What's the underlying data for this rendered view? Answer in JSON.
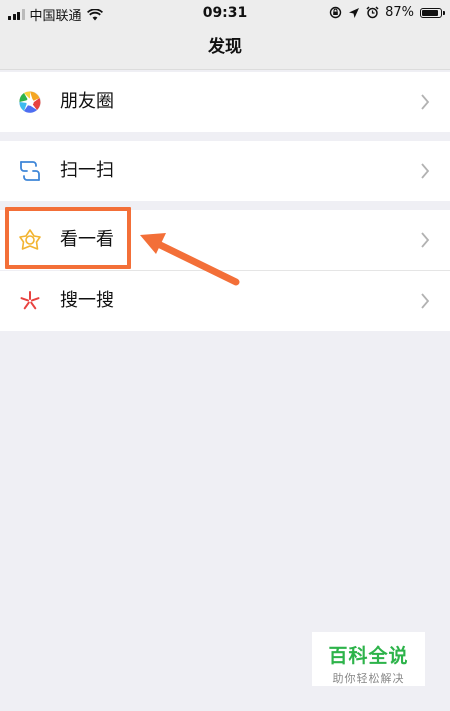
{
  "status_bar": {
    "carrier": "中国联通",
    "time": "09:31",
    "battery_percent": "87%",
    "battery_level": 0.87
  },
  "nav": {
    "title": "发现"
  },
  "menu": {
    "moments": {
      "label": "朋友圈",
      "icon": "moments-aperture-icon"
    },
    "scan": {
      "label": "扫一扫",
      "icon": "scan-icon"
    },
    "top_stories": {
      "label": "看一看",
      "icon": "top-stories-icon"
    },
    "search": {
      "label": "搜一搜",
      "icon": "search-star-icon"
    }
  },
  "colors": {
    "highlight": "#f36f38",
    "background": "#efeff4",
    "watermark_green": "#2db34a"
  },
  "watermark": {
    "title": "百科全说",
    "subtitle": "助你轻松解决"
  }
}
